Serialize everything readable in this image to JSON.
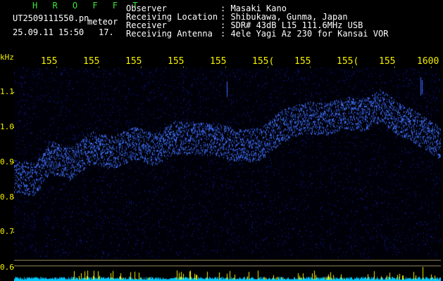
{
  "title": "H R O F F T",
  "filename": "UT2509111550.pn",
  "file_suffix": "meteor",
  "datetime": "25.09.11 15:50",
  "count": "17.",
  "info": [
    {
      "label": "Observer",
      "value": ": Masaki Kano"
    },
    {
      "label": "Receiving Location",
      "value": ": Shibukawa, Gunma, Japan"
    },
    {
      "label": "Receiver",
      "value": ": SDR# 43dB L15 111.6MHz USB"
    },
    {
      "label": "Receiving Antenna",
      "value": ": 4ele Yagi Az 230 for Kansai VOR"
    }
  ],
  "y_unit": "kHz",
  "y_ticks": [
    "1.1",
    "1.0",
    "0.9",
    "0.8",
    "0.7",
    "0.6"
  ],
  "x_ticks": [
    "155",
    "155",
    "155",
    "155",
    "155",
    "155(",
    "155",
    "155(",
    "155",
    "1600"
  ],
  "colors": {
    "background": "#000000",
    "header_text": "#ffffff",
    "title": "#39e63a",
    "axis_labels": "#f4f000",
    "signal": "#3a6bff",
    "noise": "#0b1a8a",
    "footer_level": "#00c8ff",
    "footer_spikes": "#f4f000"
  }
}
